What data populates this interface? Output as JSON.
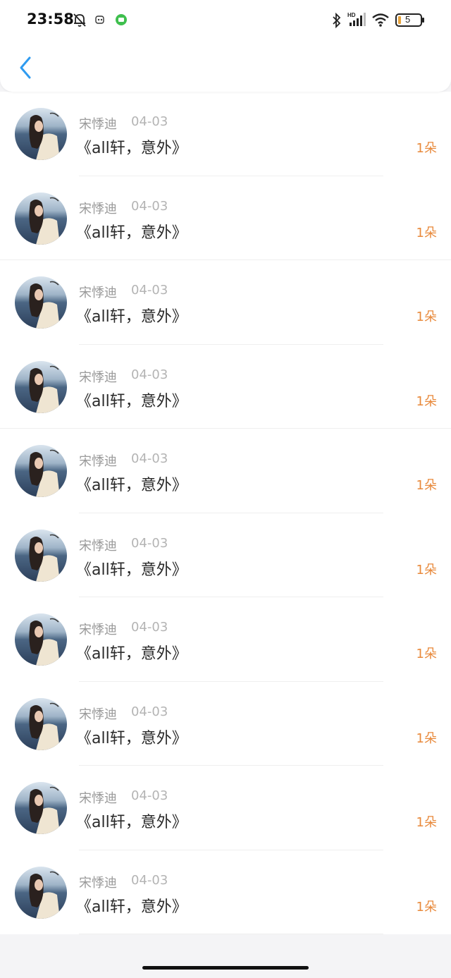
{
  "status_bar": {
    "time": "23:58",
    "battery": "5",
    "network": "HD"
  },
  "header": {
    "back_icon": "chevron-left-icon",
    "accent": "#2f9bf0"
  },
  "items": [
    {
      "name": "宋悸迪",
      "date": "04-03",
      "title": "《all轩，意外》",
      "count": "1朵"
    },
    {
      "name": "宋悸迪",
      "date": "04-03",
      "title": "《all轩，意外》",
      "count": "1朵"
    },
    {
      "name": "宋悸迪",
      "date": "04-03",
      "title": "《all轩，意外》",
      "count": "1朵"
    },
    {
      "name": "宋悸迪",
      "date": "04-03",
      "title": "《all轩，意外》",
      "count": "1朵"
    },
    {
      "name": "宋悸迪",
      "date": "04-03",
      "title": "《all轩，意外》",
      "count": "1朵"
    },
    {
      "name": "宋悸迪",
      "date": "04-03",
      "title": "《all轩，意外》",
      "count": "1朵"
    },
    {
      "name": "宋悸迪",
      "date": "04-03",
      "title": "《all轩，意外》",
      "count": "1朵"
    },
    {
      "name": "宋悸迪",
      "date": "04-03",
      "title": "《all轩，意外》",
      "count": "1朵"
    },
    {
      "name": "宋悸迪",
      "date": "04-03",
      "title": "《all轩，意外》",
      "count": "1朵"
    },
    {
      "name": "宋悸迪",
      "date": "04-03",
      "title": "《all轩，意外》",
      "count": "1朵"
    }
  ],
  "colors": {
    "count": "#e8893b",
    "name": "#9a9a9a",
    "date": "#b4b4b4"
  }
}
